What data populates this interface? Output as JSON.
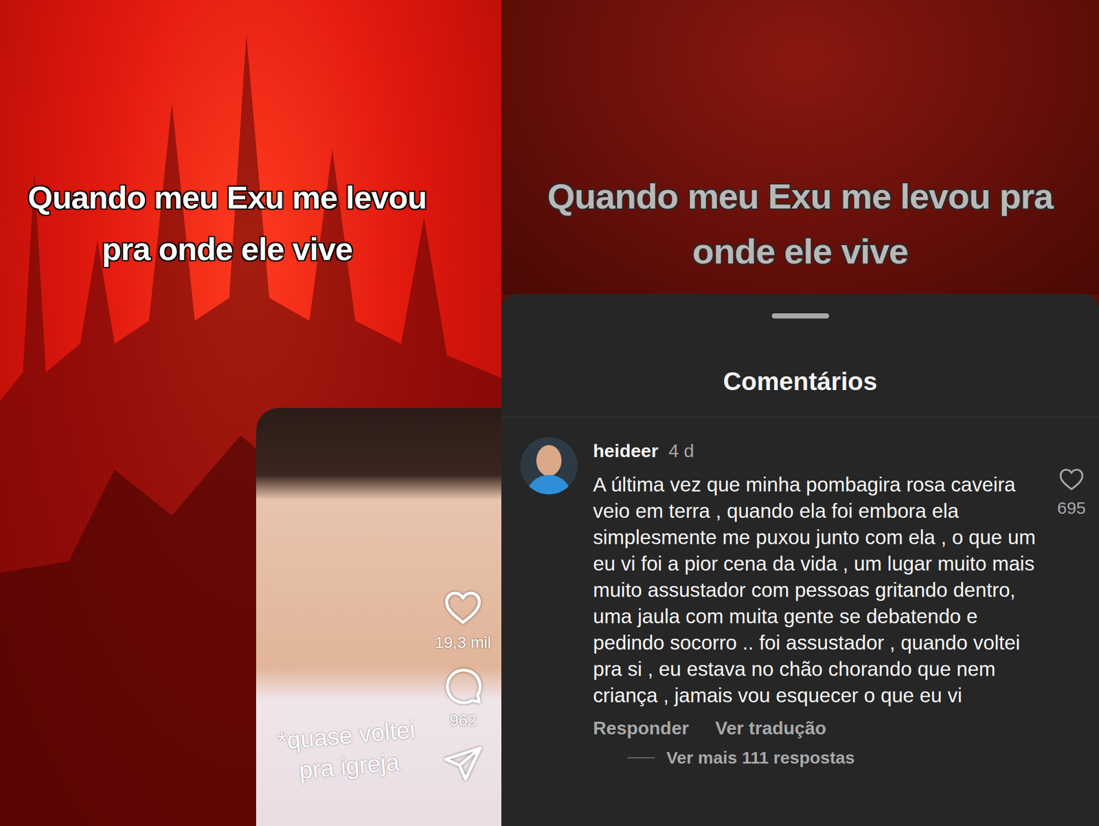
{
  "reel": {
    "caption": "Quando meu Exu me levou pra onde ele vive",
    "sticker": "*quase voltei pra igreja",
    "likes": "19,3 mil",
    "liked": false,
    "comments": "962"
  },
  "comments_sheet": {
    "title": "Comentários",
    "comments": [
      {
        "user": "heideer",
        "age": "4 d",
        "text": "A última vez que minha pombagira rosa caveira veio em terra , quando ela foi embora ela simplesmente me puxou junto com ela , o que um eu vi foi a pior cena da vida , um lugar muito mais muito assustador com pessoas gritando dentro, uma jaula com muita gente se debatendo e pedindo socorro .. foi assustador , quando voltei pra si , eu estava no chão chorando que nem criança , jamais vou esquecer o que eu vi",
        "likes": "695",
        "liked": false,
        "actions": [
          "Responder",
          "Ver tradução"
        ],
        "replies": "Ver mais 111 respostas"
      }
    ]
  }
}
